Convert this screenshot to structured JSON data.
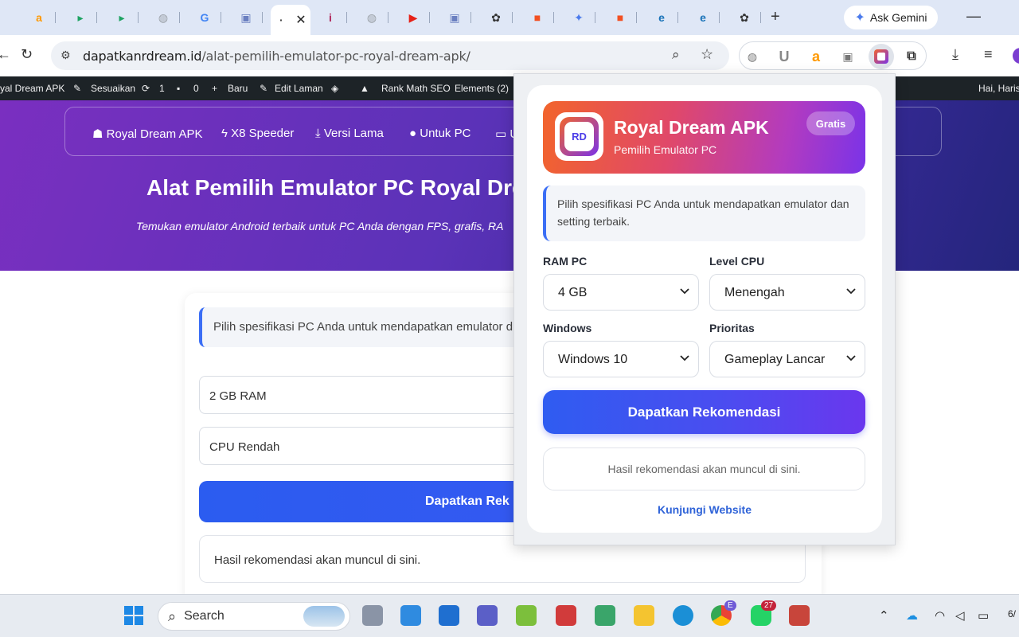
{
  "browser": {
    "tabs": [
      {
        "icon": "amazon-icon",
        "color": "#ff9900",
        "glyph": "a"
      },
      {
        "icon": "meet-icon",
        "color": "#1ea362",
        "glyph": "▸"
      },
      {
        "icon": "meet-icon",
        "color": "#1ea362",
        "glyph": "▸"
      },
      {
        "icon": "globe-icon",
        "color": "#9aa0a6",
        "glyph": "◍"
      },
      {
        "icon": "google-icon",
        "color": "#4285f4",
        "glyph": "G"
      },
      {
        "icon": "game-icon",
        "color": "#6a7fc0",
        "glyph": "▣"
      },
      {
        "icon": "page-icon",
        "color": "#ffffff",
        "glyph": "·",
        "active": true
      },
      {
        "icon": "info-icon",
        "color": "#b0265a",
        "glyph": "i"
      },
      {
        "icon": "globe-icon",
        "color": "#9aa0a6",
        "glyph": "◍"
      },
      {
        "icon": "youtube-icon",
        "color": "#e62117",
        "glyph": "▶"
      },
      {
        "icon": "game-icon",
        "color": "#6a7fc0",
        "glyph": "▣"
      },
      {
        "icon": "chatgpt-icon",
        "color": "#333333",
        "glyph": "✿"
      },
      {
        "icon": "microsoft-icon",
        "color": "#f25022",
        "glyph": "■"
      },
      {
        "icon": "gemini-icon",
        "color": "#4b7bec",
        "glyph": "✦"
      },
      {
        "icon": "microsoft-icon",
        "color": "#f25022",
        "glyph": "■"
      },
      {
        "icon": "edge-icon",
        "color": "#1a73b8",
        "glyph": "e"
      },
      {
        "icon": "edge-icon",
        "color": "#1a73b8",
        "glyph": "e"
      },
      {
        "icon": "chatgpt-icon",
        "color": "#333333",
        "glyph": "✿"
      }
    ],
    "ask_gemini": "Ask Gemini",
    "url_host": "dapatkanrdream.id",
    "url_path": "/alat-pemilih-emulator-pc-royal-dream-apk/"
  },
  "wpbar": {
    "site": "yal Dream APK",
    "customize": "Sesuaikan",
    "updates": "1",
    "comments": "0",
    "new": "Baru",
    "edit": "Edit Laman",
    "rankmath": "Rank Math SEO",
    "elements": "Elements (2)",
    "greeting": "Hai, Haris"
  },
  "page": {
    "nav": [
      "Royal Dream APK",
      "X8 Speeder",
      "Versi Lama",
      "Untuk PC",
      "U"
    ],
    "title": "Alat Pemilih Emulator PC Royal Dre",
    "subtitle": "Temukan emulator Android terbaik untuk PC Anda dengan FPS, grafis, RA",
    "info": "Pilih spesifikasi PC Anda untuk mendapatkan emulator d",
    "ram_value": "2 GB RAM",
    "cpu_value": "CPU Rendah",
    "button": "Dapatkan Rek",
    "result": "Hasil rekomendasi akan muncul di sini."
  },
  "popup": {
    "title": "Royal Dream APK",
    "subtitle": "Pemilih Emulator PC",
    "badge": "Gratis",
    "logo_text": "RD",
    "info": "Pilih spesifikasi PC Anda untuk mendapatkan emulator dan setting terbaik.",
    "fields": {
      "ram": {
        "label": "RAM PC",
        "value": "4 GB"
      },
      "cpu": {
        "label": "Level CPU",
        "value": "Menengah"
      },
      "windows": {
        "label": "Windows",
        "value": "Windows 10"
      },
      "priority": {
        "label": "Prioritas",
        "value": "Gameplay Lancar"
      }
    },
    "cta": "Dapatkan Rekomendasi",
    "result": "Hasil rekomendasi akan muncul di sini.",
    "visit": "Kunjungi Website"
  },
  "taskbar": {
    "search": "Search",
    "whatsapp_badge": "27",
    "chrome_profile": "E",
    "clock_partial": "6/"
  },
  "colors": {
    "accent_blue": "#2f5cf1",
    "accent_purple": "#6a37ee",
    "header_orange": "#f2642c",
    "link": "#2f63d8"
  }
}
